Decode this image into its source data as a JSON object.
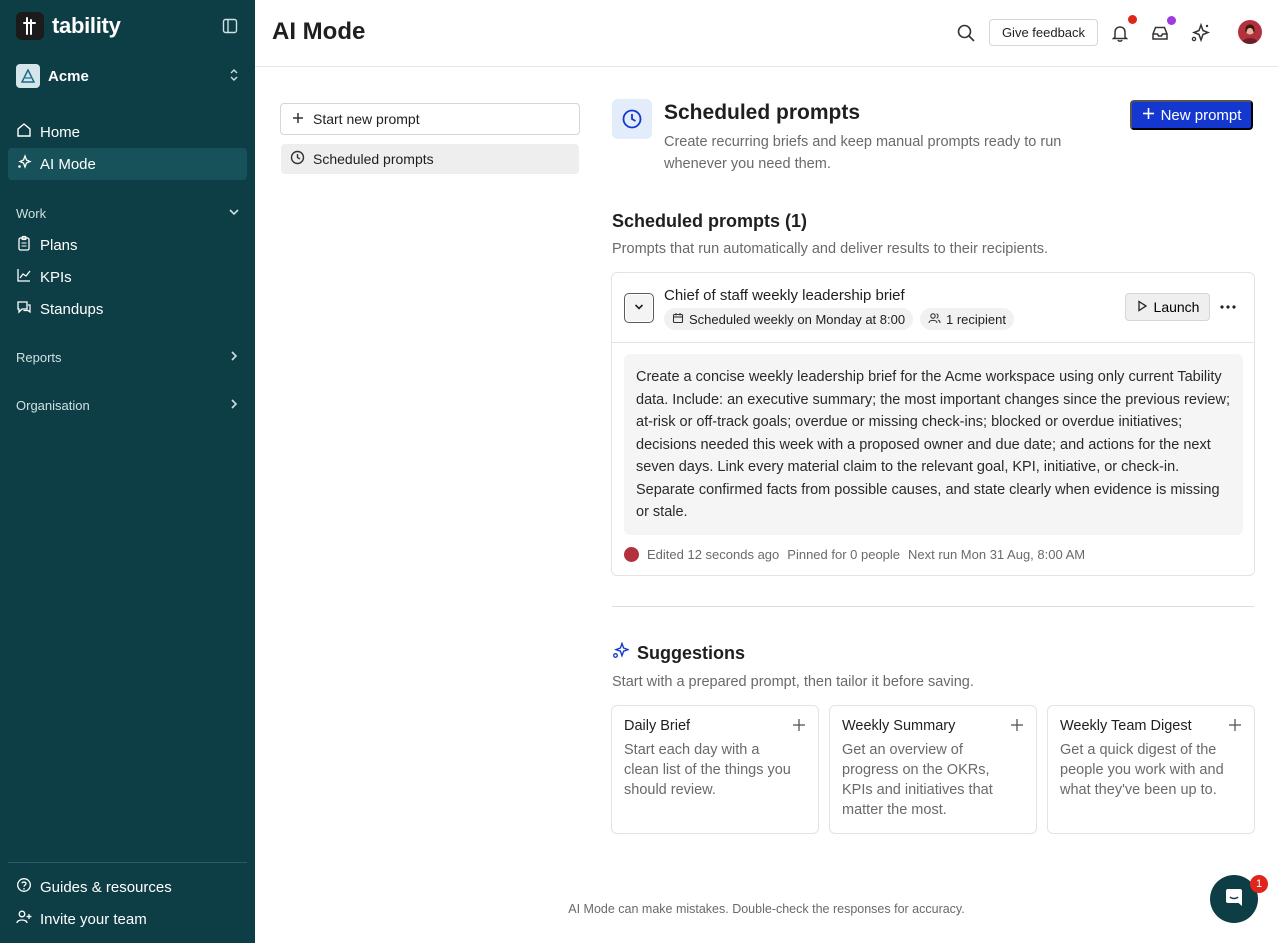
{
  "app": {
    "brand": "tability",
    "workspace": "Acme"
  },
  "sidebar": {
    "nav": [
      {
        "label": "Home",
        "icon": "home-icon"
      },
      {
        "label": "AI Mode",
        "icon": "sparkles-icon",
        "active": true
      }
    ],
    "work_section": {
      "label": "Work",
      "items": [
        {
          "label": "Plans",
          "icon": "clipboard-icon"
        },
        {
          "label": "KPIs",
          "icon": "line-chart-icon"
        },
        {
          "label": "Standups",
          "icon": "chat-icon"
        }
      ]
    },
    "reports_label": "Reports",
    "organisation_label": "Organisation",
    "footer": [
      {
        "label": "Guides & resources",
        "icon": "help-circle-icon"
      },
      {
        "label": "Invite your team",
        "icon": "add-user-icon"
      }
    ]
  },
  "header": {
    "title": "AI Mode",
    "feedback_label": "Give feedback",
    "colors": {
      "notification_dot": "#e0251b",
      "inbox_dot": "#9b3be0"
    }
  },
  "left_pane": {
    "start_label": "Start new prompt",
    "scheduled_label": "Scheduled prompts"
  },
  "hero": {
    "title": "Scheduled prompts",
    "description": "Create recurring briefs and keep manual prompts ready to run whenever you need them.",
    "new_prompt_label": "New prompt"
  },
  "scheduled": {
    "title": "Scheduled prompts (1)",
    "subtitle": "Prompts that run automatically and deliver results to their recipients.",
    "prompts": [
      {
        "name": "Chief of staff weekly leadership brief",
        "schedule": "Scheduled weekly on Monday at 8:00",
        "recipients": "1 recipient",
        "launch_label": "Launch",
        "body": "Create a concise weekly leadership brief for the Acme workspace using only current Tability data. Include: an executive summary; the most important changes since the previous review; at-risk or off-track goals; overdue or missing check-ins; blocked or overdue initiatives; decisions needed this week with a proposed owner and due date; and actions for the next seven days. Link every material claim to the relevant goal, KPI, initiative, or check-in. Separate confirmed facts from possible causes, and state clearly when evidence is missing or stale.",
        "edited": "Edited 12 seconds ago",
        "pinned": "Pinned for 0 people",
        "next_run": "Next run Mon 31 Aug, 8:00 AM"
      }
    ]
  },
  "suggestions": {
    "title": "Suggestions",
    "subtitle": "Start with a prepared prompt, then tailor it before saving.",
    "items": [
      {
        "title": "Daily Brief",
        "description": "Start each day with a clean list of the things you should review."
      },
      {
        "title": "Weekly Summary",
        "description": "Get an overview of progress on the OKRs, KPIs and initiatives that matter the most."
      },
      {
        "title": "Weekly Team Digest",
        "description": "Get a quick digest of the people you work with and what they've been up to."
      }
    ]
  },
  "disclaimer": "AI Mode can make mistakes. Double-check the responses for accuracy.",
  "chat": {
    "badge": "1"
  },
  "colors": {
    "sidebar": "#0d3d45",
    "primary": "#1438cf",
    "accent_bg": "#e2ecfb"
  }
}
